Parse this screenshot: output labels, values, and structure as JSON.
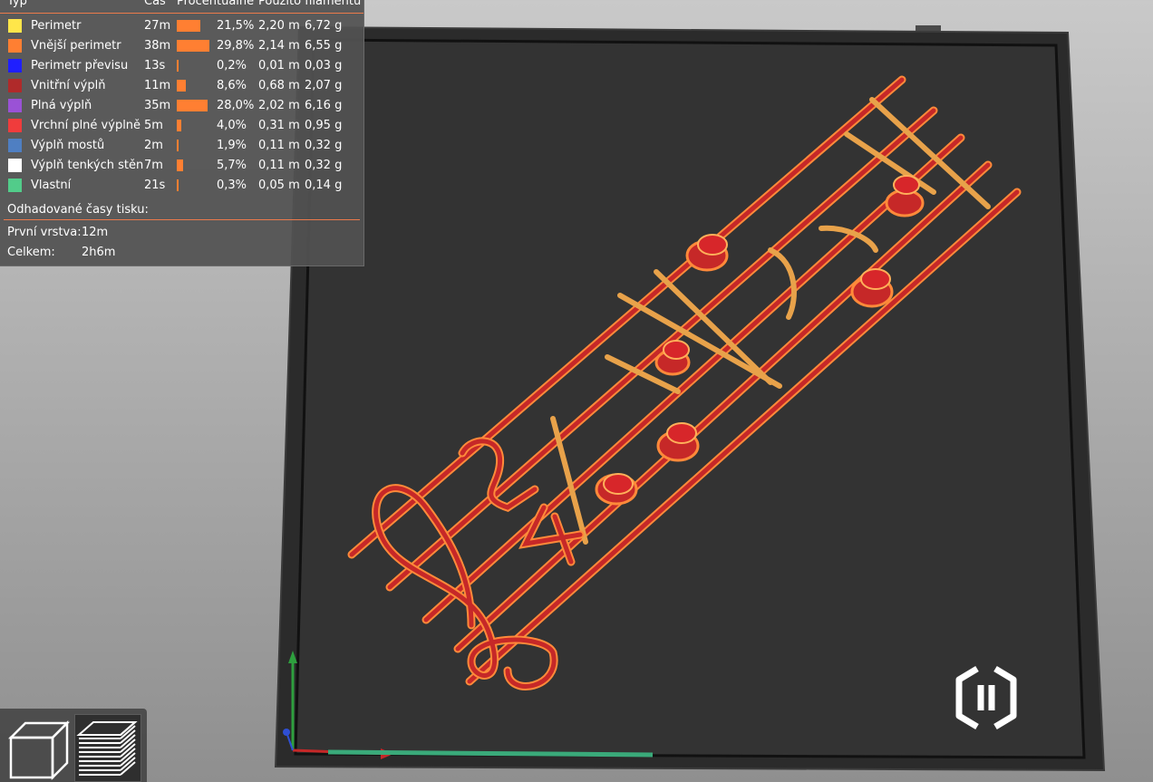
{
  "legend": {
    "headers": {
      "type": "Typ",
      "time": "Čas",
      "percent": "Procentuálně",
      "filament": "Použito filamentu"
    },
    "rows": [
      {
        "color": "#ffe64a",
        "name": "Perimetr",
        "time": "27m",
        "percent": "21,5%",
        "length": "2,20 m",
        "weight": "6,72 g",
        "fraction": 0.215
      },
      {
        "color": "#ff7f32",
        "name": "Vnější perimetr",
        "time": "38m",
        "percent": "29,8%",
        "length": "2,14 m",
        "weight": "6,55 g",
        "fraction": 0.298
      },
      {
        "color": "#1f1fff",
        "name": "Perimetr převisu",
        "time": "13s",
        "percent": "0,2%",
        "length": "0,01 m",
        "weight": "0,03 g",
        "fraction": 0.002
      },
      {
        "color": "#b02a2a",
        "name": "Vnitřní výplň",
        "time": "11m",
        "percent": "8,6%",
        "length": "0,68 m",
        "weight": "2,07 g",
        "fraction": 0.086
      },
      {
        "color": "#9a52d6",
        "name": "Plná výplň",
        "time": "35m",
        "percent": "28,0%",
        "length": "2,02 m",
        "weight": "6,16 g",
        "fraction": 0.28
      },
      {
        "color": "#f03c3c",
        "name": "Vrchní plné výplně",
        "time": "5m",
        "percent": "4,0%",
        "length": "0,31 m",
        "weight": "0,95 g",
        "fraction": 0.04
      },
      {
        "color": "#4f7fc2",
        "name": "Výplň mostů",
        "time": "2m",
        "percent": "1,9%",
        "length": "0,11 m",
        "weight": "0,32 g",
        "fraction": 0.019
      },
      {
        "color": "#ffffff",
        "name": "Výplň tenkých stěn",
        "time": "7m",
        "percent": "5,7%",
        "length": "0,11 m",
        "weight": "0,32 g",
        "fraction": 0.057
      },
      {
        "color": "#52cc8a",
        "name": "Vlastní",
        "time": "21s",
        "percent": "0,3%",
        "length": "0,05 m",
        "weight": "0,14 g",
        "fraction": 0.003
      }
    ],
    "estimated_title": "Odhadované časy tisku:",
    "first_layer_label": "První vrstva:",
    "first_layer_value": "12m",
    "total_label": "Celkem:",
    "total_value": "2h6m"
  },
  "scene": {
    "bed_color": "#333333",
    "bed_frame_color": "#2a2a2a",
    "model_color": "#c62828",
    "model_outline_color": "#ff8a3a",
    "gcode_progress_color": "#3aaa7a"
  },
  "toolbar": {
    "view_3d_icon": "cube-icon",
    "preview_icon": "layers-icon"
  }
}
